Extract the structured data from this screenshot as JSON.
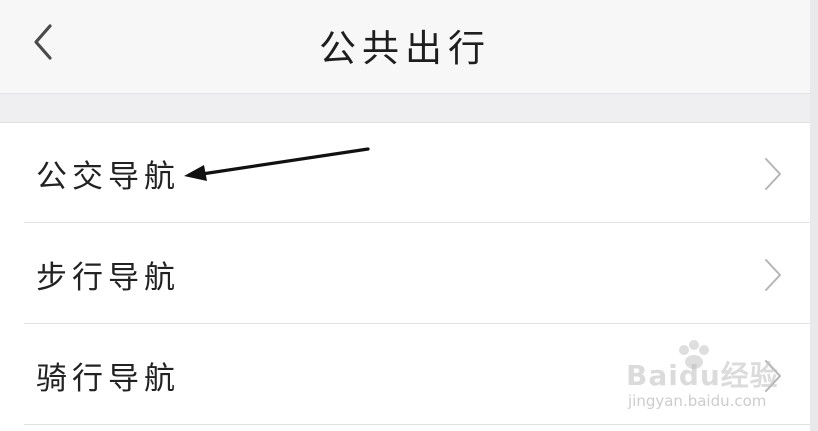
{
  "header": {
    "back_icon": "chevron-left-icon",
    "title": "公共出行"
  },
  "menu": {
    "items": [
      {
        "label": "公交导航",
        "icon": "chevron-right-icon"
      },
      {
        "label": "步行导航",
        "icon": "chevron-right-icon"
      },
      {
        "label": "骑行导航",
        "icon": "chevron-right-icon"
      }
    ]
  },
  "watermark": {
    "logo": "Baidu经验",
    "url": "jingyan.baidu.com"
  },
  "colors": {
    "nav_background": "#f7f7f7",
    "page_background": "#f1f1f3",
    "chevron": "#b5b5b5",
    "text": "#222222"
  }
}
